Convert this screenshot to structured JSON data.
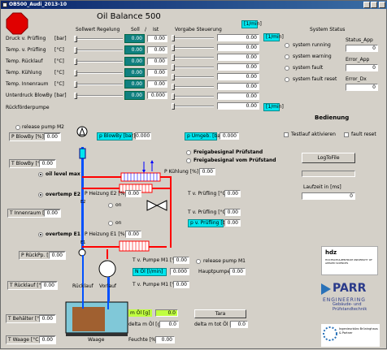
{
  "window": {
    "title": "OB500_Audi_2013-10"
  },
  "header": {
    "title": "Oil Balance 500"
  },
  "colheads": {
    "sollwert": "Sollwert Regelung",
    "soll": "Soll",
    "slash": "/",
    "ist": "Ist",
    "vorgabe": "Vorgabe Steuerung",
    "t_min": "[1/min]",
    "system_status": "System Status"
  },
  "rows": [
    {
      "label": "Druck v. Prüfling",
      "unit": "[bar]",
      "soll": "0.00",
      "ist": "0.00"
    },
    {
      "label": "Temp. v. Prüfling",
      "unit": "[°C]",
      "soll": "0.00",
      "ist": "0.00"
    },
    {
      "label": "Temp. Rücklauf",
      "unit": "[°C]",
      "soll": "0.00",
      "ist": "0.00"
    },
    {
      "label": "Temp. Kühlung",
      "unit": "[°C]",
      "soll": "0.00",
      "ist": "0.00"
    },
    {
      "label": "Temp. Innenraum",
      "unit": "[°C]",
      "soll": "0.00",
      "ist": "0.00"
    },
    {
      "label": "Unterdruck BlowBy",
      "unit": "[bar]",
      "soll": "0.00",
      "ist": "0.000"
    }
  ],
  "rueckfoerder": "Rückförderpumpe",
  "vorgabe": {
    "values": [
      "0.00",
      "0.00",
      "0.00",
      "0.00",
      "0.00",
      "0.00",
      "0.00",
      "0.00"
    ],
    "units": [
      "[1/min]",
      "[1/min]"
    ]
  },
  "status": {
    "radios": [
      "system running",
      "system warning",
      "system fault",
      "system fault reset"
    ],
    "app_label": "Status_App",
    "app_value": "0",
    "error_app_label": "Error_App",
    "error_app_value": "0",
    "error_dx_label": "Error_Dx",
    "error_dx_value": "0"
  },
  "bedienung": {
    "title": "Bedienung",
    "testlauf": "Testlauf aktivieren",
    "fault_reset": "fault reset",
    "log_button": "LogToFile",
    "laufzeit_label": "Laufzeit in [ms]",
    "laufzeit_value": "0"
  },
  "diagram": {
    "release_m2": "release pump M2",
    "p_blowby_s": "P BlowBy [%]",
    "p_blowby_s_val": "0.00",
    "p_blowby_bar": "p BlowBy [bar]",
    "p_blowby_bar_val": "0.000",
    "p_umgeb": "p Umgeb. [bar]",
    "p_umgeb_val": "0.000",
    "freigabe1": "Freigabesignal Prüfstand",
    "freigabe2": "Freigabesignal vom Prüfstand",
    "t_blowby": "T BlowBy [°C]",
    "t_blowby_val": "0.00",
    "oil_max": "oil level max",
    "p_kuehlung": "P Kühlung [%]",
    "p_kuehlung_val": "0.00",
    "overtemp_e2": "overtemp E2",
    "p_heizung_e2": "P Heizung E2 [%]",
    "p_heizung_e2_val": "0.00",
    "e2": "E2",
    "e1_label": "E1",
    "on1": "on",
    "on2": "on",
    "t_v_pruefling": "T v. Prüfling [°C]",
    "t_v_pruefling_val": "0.00",
    "t_innenraum": "T Innenraum [°C]",
    "t_innenraum_val": "0.00",
    "t_v_pruefling2": "T v. Prüfling [°C]",
    "t_v_pruefling2_val": "0.00",
    "p_v_pruefling": "p v. Prüfling [bar]",
    "p_v_pruefling_val": "0.00",
    "overtemp_e1": "overtemp E1",
    "p_heizung_e1": "P Heizung E1 [%]",
    "p_heizung_e1_val": "0.00",
    "p_rueckpumpe": "P RückPp. [%]",
    "p_rueckpumpe_val": "0.00",
    "t_pumpe_m1": "T v. Pumpe M1 [°C]",
    "t_pumpe_m1_val": "0.00",
    "release_m1": "release pump M1",
    "n_oel": "N Öl [l/min]",
    "n_oel_val": "0.000",
    "hauptpumpe": "Hauptpumpe [%]",
    "hauptpumpe_val": "0.00",
    "t_v_pumpe_m1": "T v. Pumpe M1 [°C]",
    "t_v_pumpe_m1_val": "0.00",
    "t_ruecklauf": "T Rücklauf [°C]",
    "t_ruecklauf_val": "0.00",
    "ruecklauf": "Rücklauf",
    "vorlauf": "Vorlauf",
    "t_behaelter": "T Behälter [°C]",
    "t_behaelter_val": "0.00",
    "t_waage": "T Waage  [°C]",
    "t_waage_val": "0.00",
    "m_oel": "m Öl [g]",
    "m_oel_val": "0.0",
    "delta_m_oel": "delta m Öl [g]",
    "delta_m_oel_val": "0.0",
    "tara": "Tara",
    "delta_m_tot": "delta m tot Öl [g]",
    "delta_m_tot_val": "0.0",
    "feuchte": "Feuchte [%]",
    "feuchte_val": "0.00",
    "waage": "Waage"
  },
  "logos": {
    "hdz_name": "hdz",
    "hdz_sub": "HOCHSCHULZENTRUM UNIVERSITY OF APPLIED SCIENCES",
    "parr": "PARR",
    "engineering": "ENGINEERING",
    "gebaeude": "Gebäude- und Prüfstandtechnik",
    "ib_name": "Ingenieurbüro Brüninghaus & Partner"
  },
  "colors": {
    "teal": "#108080",
    "cyan": "#00e5ee",
    "red_pipe": "#ff0000",
    "blue_pipe": "#0050ff",
    "stop": "#e00000",
    "lime": "#c0ff40",
    "tank": "#80c8d8"
  }
}
